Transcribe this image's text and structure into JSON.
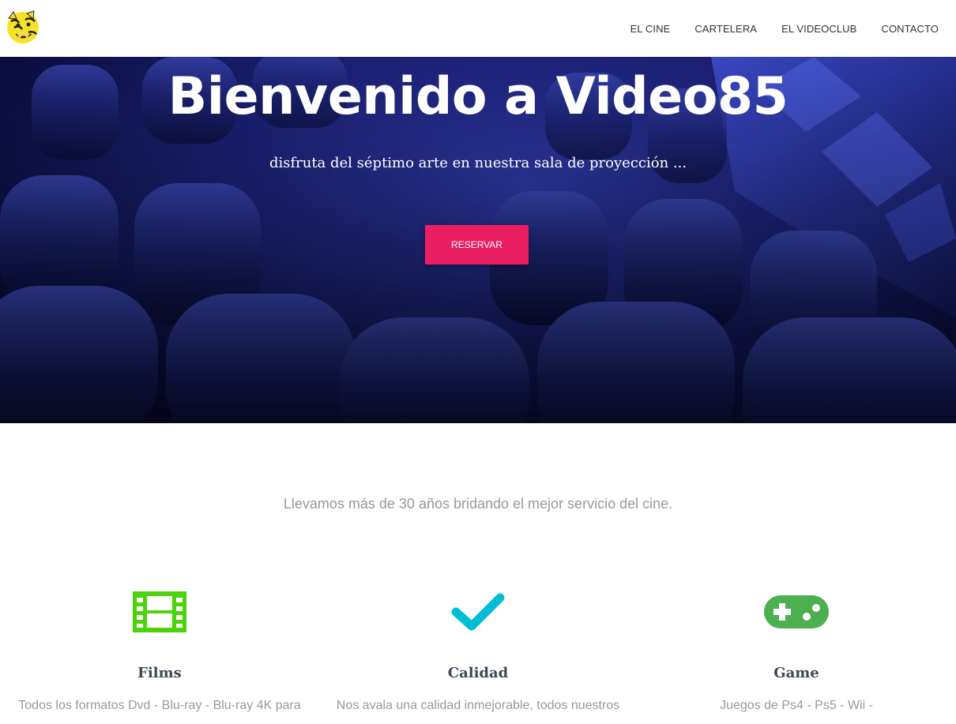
{
  "nav": {
    "logo_alt": "tiger-logo",
    "items": [
      {
        "label": "EL CINE"
      },
      {
        "label": "CARTELERA"
      },
      {
        "label": "EL VIDEOCLUB"
      },
      {
        "label": "CONTACTO"
      }
    ]
  },
  "hero": {
    "title": "Bienvenido a Video85",
    "subtitle": "disfruta del séptimo arte en nuestra sala de proyección ...",
    "button": "RESERVAR"
  },
  "intro": "Llevamos más de 30 años bridando el mejor servicio del cine.",
  "features": [
    {
      "icon": "film-icon",
      "title": "Films",
      "text": "Todos los formatos Dvd - Blu-ray - Blu-ray 4K para",
      "color": "#4cd40b"
    },
    {
      "icon": "check-icon",
      "title": "Calidad",
      "text": "Nos avala una calidad inmejorable, todos nuestros",
      "color": "#00bcd4"
    },
    {
      "icon": "gamepad-icon",
      "title": "Game",
      "text": "Juegos de Ps4 - Ps5 - Wii -",
      "color": "#4caf50"
    }
  ],
  "colors": {
    "accent": "#e91e63",
    "hero_bg": "#1c2177",
    "title_text": "#3c4858",
    "muted_text": "#999999"
  }
}
